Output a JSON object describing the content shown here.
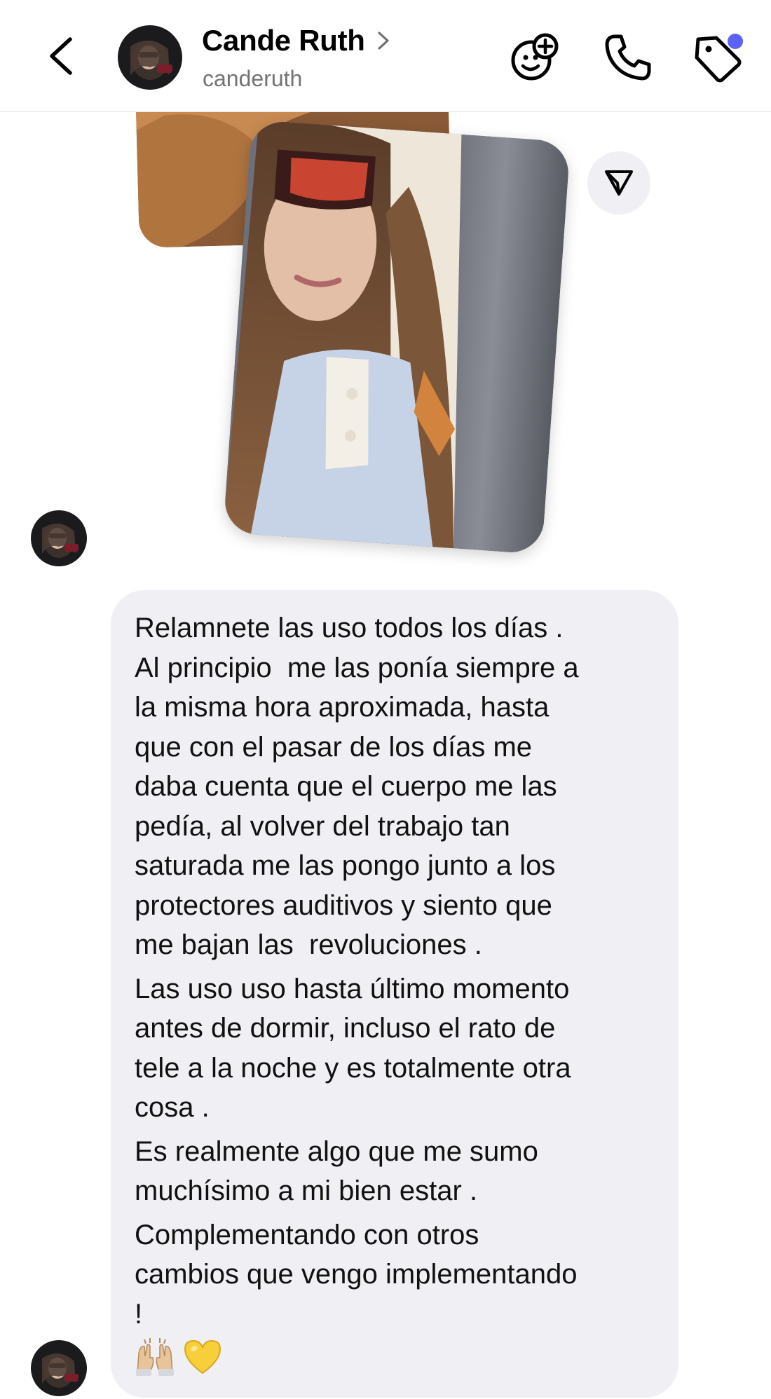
{
  "header": {
    "contact_name": "Cande Ruth",
    "username": "canderuth",
    "icons": {
      "back": "chevron-left-icon",
      "name_chevron": "chevron-right-icon",
      "effects": "face-plus-icon",
      "call": "phone-icon",
      "tag": "tag-icon"
    },
    "notification_dot_color": "#5b62f5"
  },
  "media": {
    "share_icon": "send-icon"
  },
  "message": {
    "paragraphs": [
      [
        "Relamnete las uso todos los días .",
        "Al principio  me las ponía siempre a",
        "la misma hora aproximada, hasta",
        "que con el pasar de los días me",
        "daba cuenta que el cuerpo me las",
        "pedía, al volver del trabajo tan",
        "saturada me las pongo junto a los",
        "protectores auditivos y siento que",
        "me bajan las  revoluciones ."
      ],
      [
        "Las uso uso hasta último momento",
        "antes de dormir, incluso el rato de",
        "tele a la noche y es totalmente otra",
        "cosa ."
      ],
      [
        "Es realmente algo que me sumo",
        "muchísimo a mi bien estar ."
      ],
      [
        "Complementando con otros",
        "cambios que vengo implementando",
        "!"
      ]
    ],
    "emojis": [
      "raising-hands-emoji",
      "yellow-heart-emoji"
    ],
    "bubble_color": "#efeff4"
  }
}
